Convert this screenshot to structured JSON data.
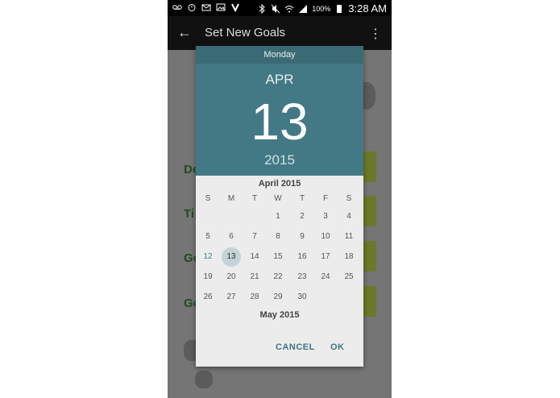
{
  "status_bar": {
    "battery": "100%",
    "time": "3:28 AM"
  },
  "app_bar": {
    "title": "Set New Goals"
  },
  "background": {
    "labels": [
      "De",
      "Ti",
      "Go",
      "Go"
    ]
  },
  "dialog": {
    "weekday": "Monday",
    "month": "APR",
    "day": "13",
    "year": "2015",
    "calendar_title": "April 2015",
    "day_headers": [
      "S",
      "M",
      "T",
      "W",
      "T",
      "F",
      "S"
    ],
    "next_month_title": "May 2015",
    "buttons": {
      "cancel": "CANCEL",
      "ok": "OK"
    }
  },
  "colors": {
    "accent": "#427985",
    "header_dark": "#3a6b75",
    "selected_circle": "#c3d3d6"
  }
}
